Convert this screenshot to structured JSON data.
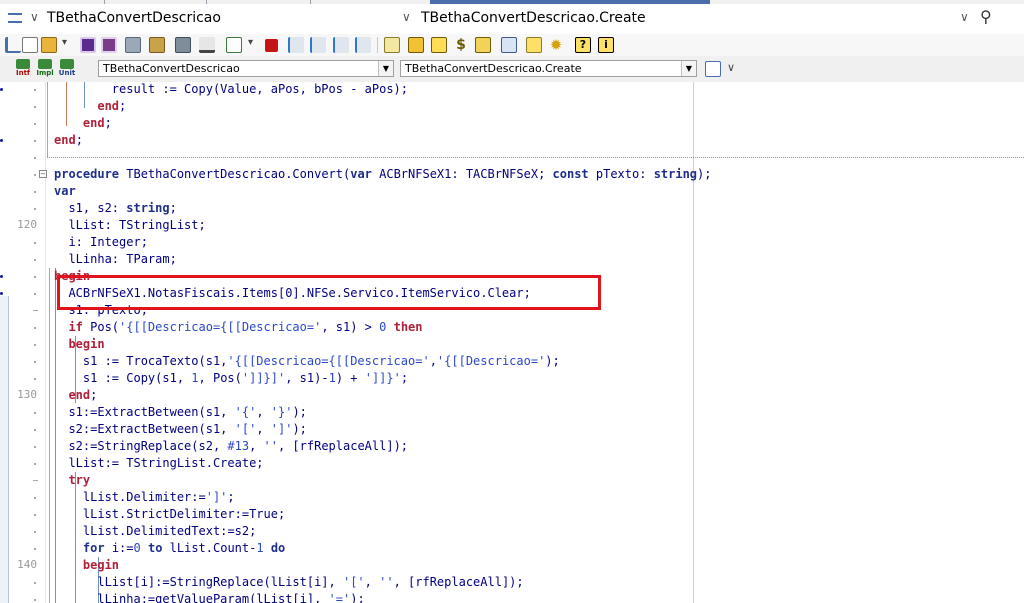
{
  "nav": {
    "left_title": "TBethaConvertDescricao",
    "right_title": "TBethaConvertDescricao.Create"
  },
  "toolbar2": {
    "intf_label": "Intf",
    "impl_label": "Impl",
    "unit_label": "Unit",
    "class_combo": "TBethaConvertDescricao",
    "method_combo": "TBethaConvertDescricao.Create"
  },
  "gutter_numbers": {
    "n120": "120",
    "n130": "130",
    "n140": "140"
  },
  "code_lines": [
    [
      {
        "t": "        result := Copy(Value, aPos, bPos - aPos);",
        "c": "id"
      }
    ],
    [
      {
        "t": "      ",
        "c": "id"
      },
      {
        "t": "end",
        "c": "kw"
      },
      {
        "t": ";",
        "c": "id"
      }
    ],
    [
      {
        "t": "    ",
        "c": "id"
      },
      {
        "t": "end",
        "c": "kw"
      },
      {
        "t": ";",
        "c": "id"
      }
    ],
    [
      {
        "t": "end",
        "c": "kw"
      },
      {
        "t": ";",
        "c": "id"
      }
    ],
    [
      {
        "t": "",
        "c": "id"
      }
    ],
    [
      {
        "t": "procedure",
        "c": "kw2"
      },
      {
        "t": " TBethaConvertDescricao.Convert(",
        "c": "id"
      },
      {
        "t": "var",
        "c": "kw2"
      },
      {
        "t": " ACBrNFSeX1: TACBrNFSeX; ",
        "c": "id"
      },
      {
        "t": "const",
        "c": "kw2"
      },
      {
        "t": " pTexto: ",
        "c": "id"
      },
      {
        "t": "string",
        "c": "kw2"
      },
      {
        "t": ");",
        "c": "id"
      }
    ],
    [
      {
        "t": "var",
        "c": "kw2"
      }
    ],
    [
      {
        "t": "  s1, s2: ",
        "c": "id"
      },
      {
        "t": "string",
        "c": "kw2"
      },
      {
        "t": ";",
        "c": "id"
      }
    ],
    [
      {
        "t": "  lList: TStringList;",
        "c": "id"
      }
    ],
    [
      {
        "t": "  i: Integer;",
        "c": "id"
      }
    ],
    [
      {
        "t": "  lLinha: TParam;",
        "c": "id"
      }
    ],
    [
      {
        "t": "begin",
        "c": "kw"
      }
    ],
    [
      {
        "t": "  ACBrNFSeX1.NotasFiscais.Items[0].NFSe.Servico.ItemServico.Clear;",
        "c": "id"
      }
    ],
    [
      {
        "t": "  s1: pTexto;",
        "c": "id"
      }
    ],
    [
      {
        "t": "  ",
        "c": "id"
      },
      {
        "t": "if",
        "c": "kw"
      },
      {
        "t": " Pos(",
        "c": "id"
      },
      {
        "t": "'{[[Descricao={[[Descricao='",
        "c": "str"
      },
      {
        "t": ", s1) > ",
        "c": "id"
      },
      {
        "t": "0",
        "c": "num"
      },
      {
        "t": " ",
        "c": "id"
      },
      {
        "t": "then",
        "c": "kw"
      }
    ],
    [
      {
        "t": "  ",
        "c": "id"
      },
      {
        "t": "begin",
        "c": "kw"
      }
    ],
    [
      {
        "t": "    s1 := TrocaTexto(s1,",
        "c": "id"
      },
      {
        "t": "'{[[Descricao={[[Descricao='",
        "c": "str"
      },
      {
        "t": ",",
        "c": "id"
      },
      {
        "t": "'{[[Descricao='",
        "c": "str"
      },
      {
        "t": ");",
        "c": "id"
      }
    ],
    [
      {
        "t": "    s1 := Copy(s1, ",
        "c": "id"
      },
      {
        "t": "1",
        "c": "num"
      },
      {
        "t": ", Pos(",
        "c": "id"
      },
      {
        "t": "']]}]'",
        "c": "str"
      },
      {
        "t": ", s1)-",
        "c": "id"
      },
      {
        "t": "1",
        "c": "num"
      },
      {
        "t": ") + ",
        "c": "id"
      },
      {
        "t": "']]}'",
        "c": "str"
      },
      {
        "t": ";",
        "c": "id"
      }
    ],
    [
      {
        "t": "  ",
        "c": "id"
      },
      {
        "t": "end",
        "c": "kw"
      },
      {
        "t": ";",
        "c": "id"
      }
    ],
    [
      {
        "t": "  s1:=ExtractBetween(s1, ",
        "c": "id"
      },
      {
        "t": "'{'",
        "c": "str"
      },
      {
        "t": ", ",
        "c": "id"
      },
      {
        "t": "'}'",
        "c": "str"
      },
      {
        "t": ");",
        "c": "id"
      }
    ],
    [
      {
        "t": "  s2:=ExtractBetween(s1, ",
        "c": "id"
      },
      {
        "t": "'['",
        "c": "str"
      },
      {
        "t": ", ",
        "c": "id"
      },
      {
        "t": "']'",
        "c": "str"
      },
      {
        "t": ");",
        "c": "id"
      }
    ],
    [
      {
        "t": "  s2:=StringReplace(s2, ",
        "c": "id"
      },
      {
        "t": "#13",
        "c": "num"
      },
      {
        "t": ", ",
        "c": "id"
      },
      {
        "t": "''",
        "c": "str"
      },
      {
        "t": ", [rfReplaceAll]);",
        "c": "id"
      }
    ],
    [
      {
        "t": "  lList:= TStringList.Create;",
        "c": "id"
      }
    ],
    [
      {
        "t": "  ",
        "c": "id"
      },
      {
        "t": "try",
        "c": "kw"
      }
    ],
    [
      {
        "t": "    lList.Delimiter:=",
        "c": "id"
      },
      {
        "t": "']'",
        "c": "str"
      },
      {
        "t": ";",
        "c": "id"
      }
    ],
    [
      {
        "t": "    lList.StrictDelimiter:=True;",
        "c": "id"
      }
    ],
    [
      {
        "t": "    lList.DelimitedText:=s2;",
        "c": "id"
      }
    ],
    [
      {
        "t": "    ",
        "c": "id"
      },
      {
        "t": "for",
        "c": "kw2"
      },
      {
        "t": " i:=",
        "c": "id"
      },
      {
        "t": "0",
        "c": "num"
      },
      {
        "t": " ",
        "c": "id"
      },
      {
        "t": "to",
        "c": "kw2"
      },
      {
        "t": " lList.Count-",
        "c": "id"
      },
      {
        "t": "1",
        "c": "num"
      },
      {
        "t": " ",
        "c": "id"
      },
      {
        "t": "do",
        "c": "kw2"
      }
    ],
    [
      {
        "t": "    ",
        "c": "id"
      },
      {
        "t": "begin",
        "c": "kw"
      }
    ],
    [
      {
        "t": "      lList[i]:=StringReplace(lList[i], ",
        "c": "id"
      },
      {
        "t": "'['",
        "c": "str"
      },
      {
        "t": ", ",
        "c": "id"
      },
      {
        "t": "''",
        "c": "str"
      },
      {
        "t": ", [rfReplaceAll]);",
        "c": "id"
      }
    ],
    [
      {
        "t": "      lLinha:=getValueParam(lList[i], ",
        "c": "id"
      },
      {
        "t": "'='",
        "c": "str"
      },
      {
        "t": ");",
        "c": "id"
      }
    ]
  ],
  "colors": {
    "highlight_box": "#e0141c",
    "keyword": "#b0203a",
    "keyword_alt": "#1e2f8a",
    "string": "#2c48c8",
    "identifier": "#000080"
  }
}
